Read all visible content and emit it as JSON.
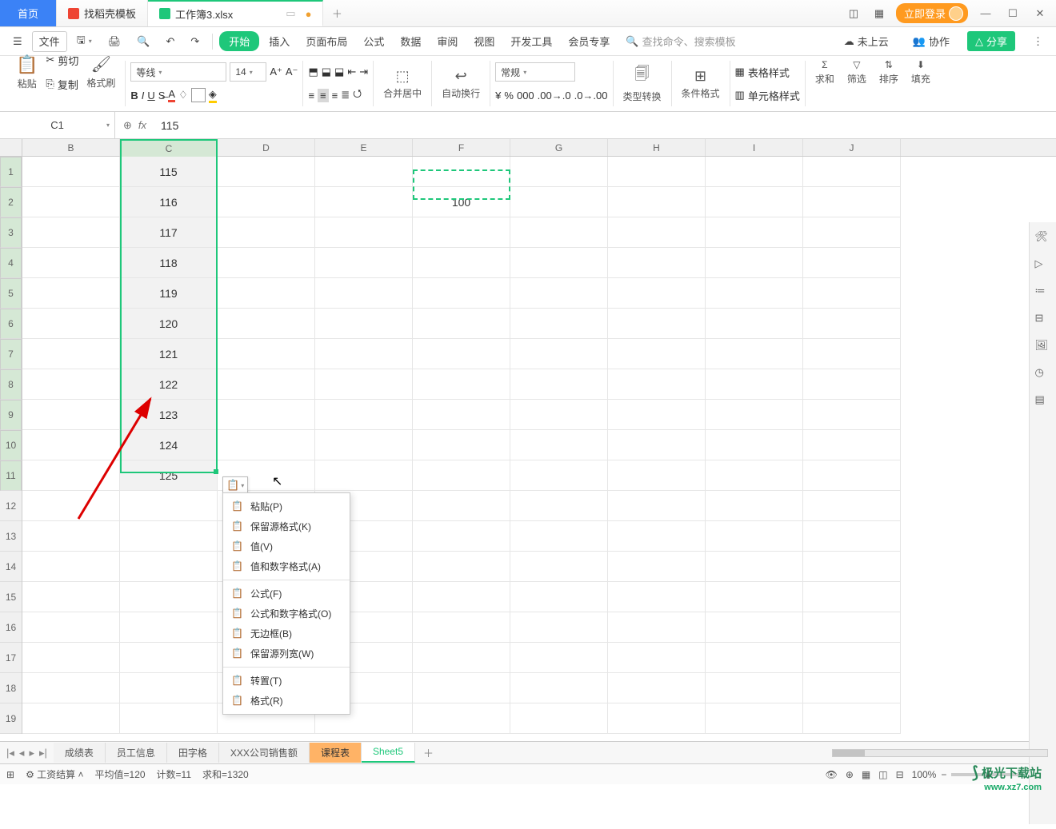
{
  "titlebar": {
    "home": "首页",
    "tab1": "找稻壳模板",
    "tab2": "工作簿3.xlsx",
    "login": "立即登录"
  },
  "menubar": {
    "file": "文件",
    "start": "开始",
    "insert": "插入",
    "layout": "页面布局",
    "formula": "公式",
    "data": "数据",
    "review": "审阅",
    "view": "视图",
    "dev": "开发工具",
    "member": "会员专享",
    "search_ph": "查找命令、搜索模板",
    "cloud": "未上云",
    "collab": "协作",
    "share": "分享"
  },
  "ribbon": {
    "paste": "粘贴",
    "cut": "剪切",
    "copy": "复制",
    "fmtpaint": "格式刷",
    "font": "等线",
    "size": "14",
    "merge": "合并居中",
    "wrap": "自动换行",
    "numfmt": "常规",
    "typeconv": "类型转换",
    "condfmt": "条件格式",
    "tblstyle": "表格样式",
    "cellstyle": "单元格样式",
    "sum": "求和",
    "filter": "筛选",
    "sort": "排序",
    "fill": "填充"
  },
  "namebox": "C1",
  "fxvalue": "115",
  "columns": [
    "B",
    "C",
    "D",
    "E",
    "F",
    "G",
    "H",
    "I",
    "J"
  ],
  "col_widths": {
    "B": 122,
    "C": 122,
    "D": 122,
    "E": 122,
    "F": 122,
    "G": 122,
    "H": 122,
    "I": 122,
    "J": 122
  },
  "rows": [
    1,
    2,
    3,
    4,
    5,
    6,
    7,
    8,
    9,
    10,
    11,
    12,
    13,
    14,
    15,
    16,
    17,
    18,
    19
  ],
  "cell_data": {
    "C1": "115",
    "C2": "116",
    "C3": "117",
    "C4": "118",
    "C5": "119",
    "C6": "120",
    "C7": "121",
    "C8": "122",
    "C9": "123",
    "C10": "124",
    "C11": "125",
    "F2": "100"
  },
  "selection": {
    "range": "C1:C11",
    "active": "C1"
  },
  "copied_range": "F2",
  "context_menu": [
    {
      "label": "粘贴(P)",
      "icon": "paste"
    },
    {
      "label": "保留源格式(K)",
      "icon": "paste-fmt"
    },
    {
      "label": "值(V)",
      "icon": "paste-val"
    },
    {
      "label": "值和数字格式(A)",
      "icon": "paste-valfmt"
    },
    {
      "sep": true
    },
    {
      "label": "公式(F)",
      "icon": "paste-fx"
    },
    {
      "label": "公式和数字格式(O)",
      "icon": "paste-fxfmt"
    },
    {
      "label": "无边框(B)",
      "icon": "paste-nobrd"
    },
    {
      "label": "保留源列宽(W)",
      "icon": "paste-colw"
    },
    {
      "sep": true
    },
    {
      "label": "转置(T)",
      "icon": "paste-transp"
    },
    {
      "label": "格式(R)",
      "icon": "paste-fmtonly"
    }
  ],
  "sheets": [
    {
      "name": "成绩表"
    },
    {
      "name": "员工信息"
    },
    {
      "name": "田字格"
    },
    {
      "name": "XXX公司销售额"
    },
    {
      "name": "课程表",
      "orange": true
    },
    {
      "name": "Sheet5",
      "active": true
    }
  ],
  "status": {
    "calc": "工资结算",
    "avg": "平均值=120",
    "count": "计数=11",
    "sum": "求和=1320",
    "zoom": "100%"
  },
  "watermark": {
    "brand": "极光下载站",
    "url": "www.xz7.com"
  }
}
